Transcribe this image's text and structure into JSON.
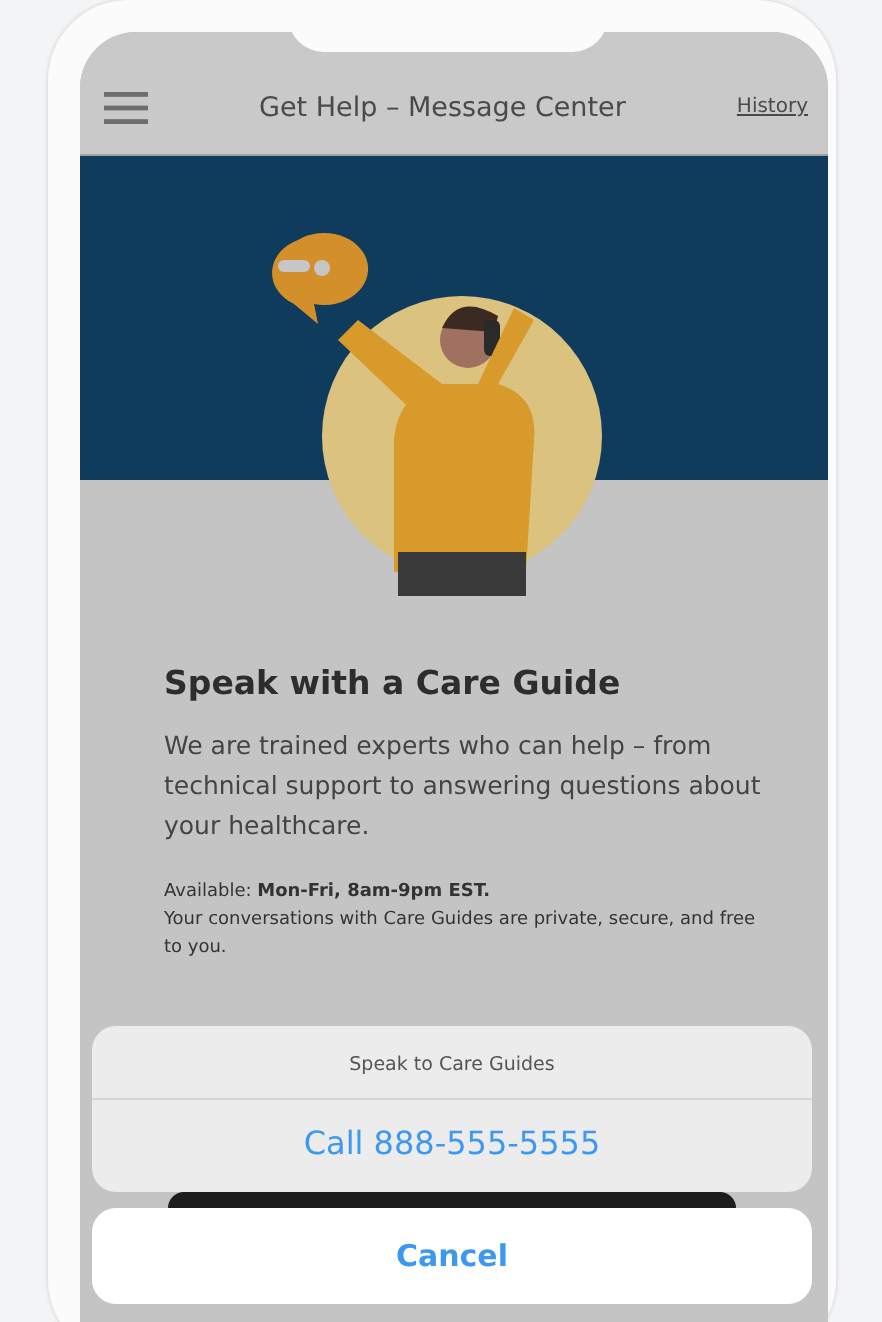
{
  "nav_bar": {
    "title": "Get Help – Message Center",
    "history_link": "History"
  },
  "content": {
    "heading": "Speak with a Care Guide",
    "body": "We are trained experts who can help – from technical support to answering questions about your healthcare.",
    "availability": "Available: **Mon-Fri, 8am-9pm EST.**",
    "privacy": "Your conversations with Care Guides are private, secure, and free to you."
  },
  "action_sheet": {
    "title": "Speak to Care Guides",
    "actions": [
      {
        "label": "Call 888-555-5555"
      }
    ],
    "cancel": "Cancel"
  }
}
